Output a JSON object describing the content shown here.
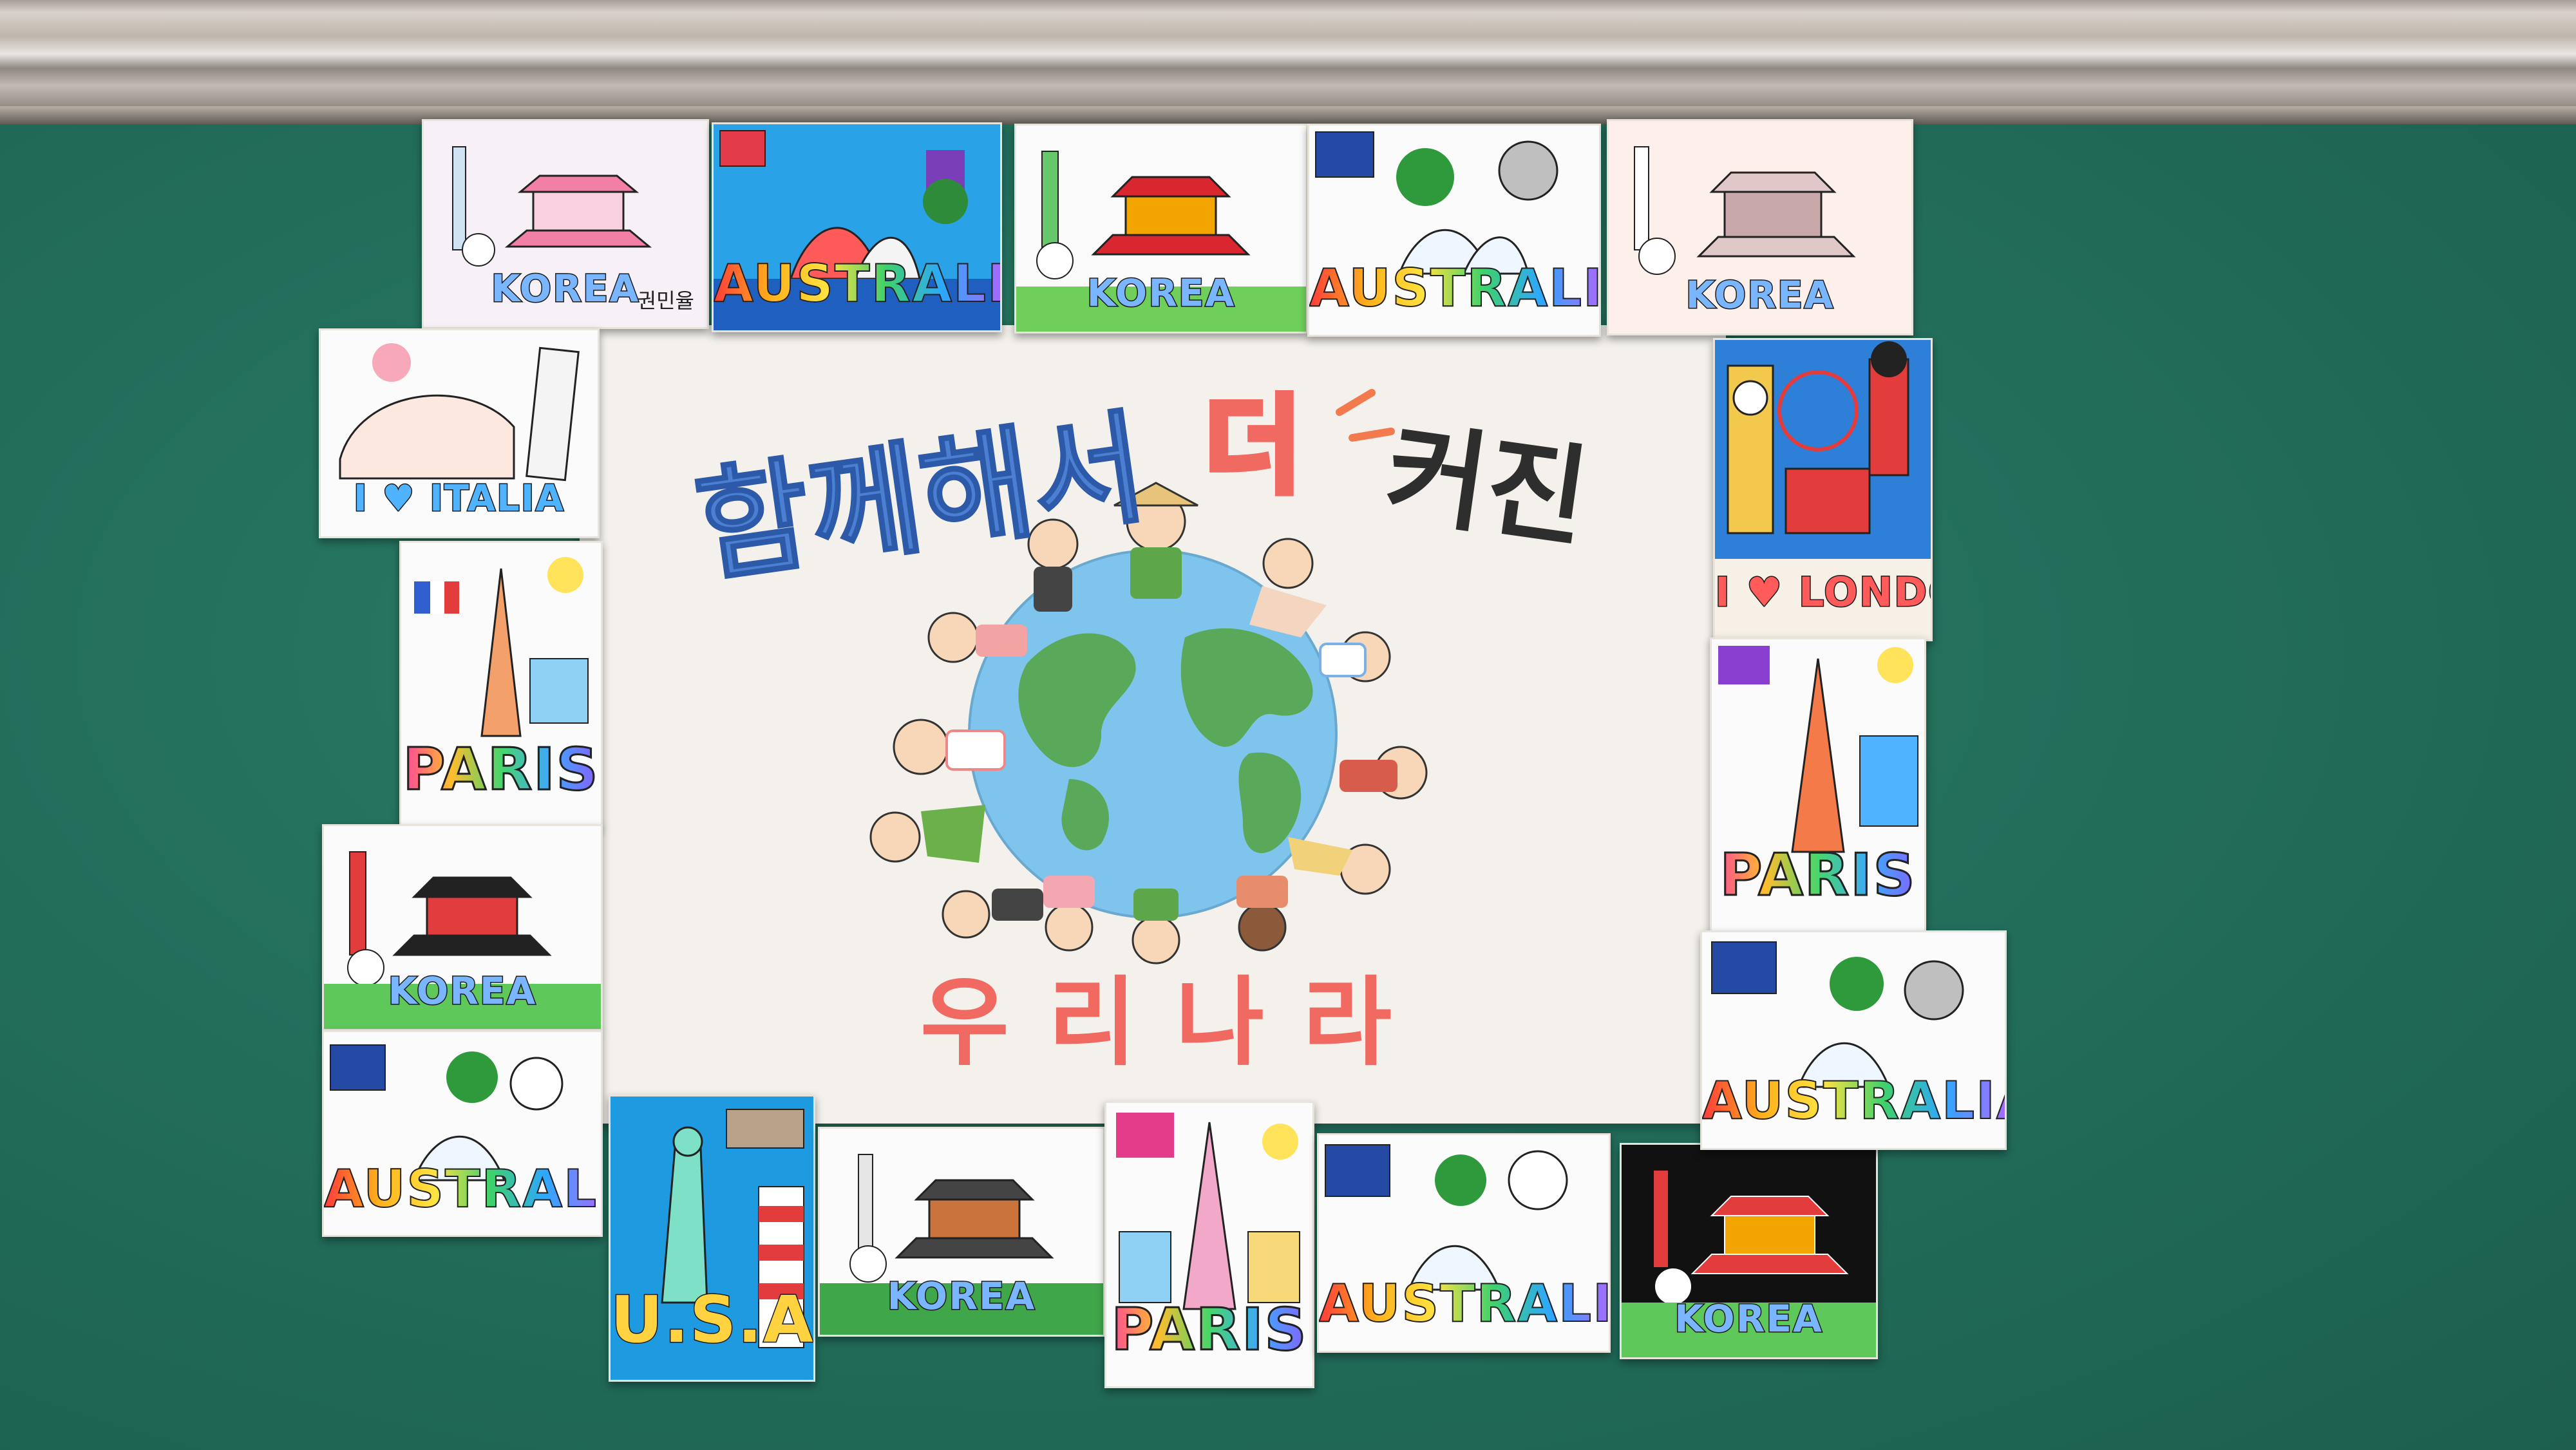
{
  "poster": {
    "title_line1_a": "함께해서",
    "title_line1_b": "더",
    "title_line1_c": "커진",
    "title_line2": "우리나라"
  },
  "cards": [
    {
      "label": "KOREA",
      "signature": "권민율"
    },
    {
      "label": "AUSTRALIA"
    },
    {
      "label": "KOREA"
    },
    {
      "label": "AUSTRALIA"
    },
    {
      "label": "KOREA"
    },
    {
      "label": "I ♥ ITALIA"
    },
    {
      "label": "PARIS"
    },
    {
      "label": "KOREA"
    },
    {
      "label": "AUSTRALIA"
    },
    {
      "label": "U.S.A"
    },
    {
      "label": "KOREA"
    },
    {
      "label": "PARIS"
    },
    {
      "label": "AUSTRALIA"
    },
    {
      "label": "KOREA"
    },
    {
      "label": "I ♥ LONDON"
    },
    {
      "label": "PARIS"
    },
    {
      "label": "AUSTRALIA"
    }
  ],
  "colors": {
    "board": "#236f5c",
    "poster": "#f4f1ec",
    "title_blue": "#4a7fd1",
    "title_dark": "#2e2e2e",
    "title_red": "#f06a62",
    "earth_ocean": "#7fc4ec",
    "earth_land": "#5aa85a"
  }
}
